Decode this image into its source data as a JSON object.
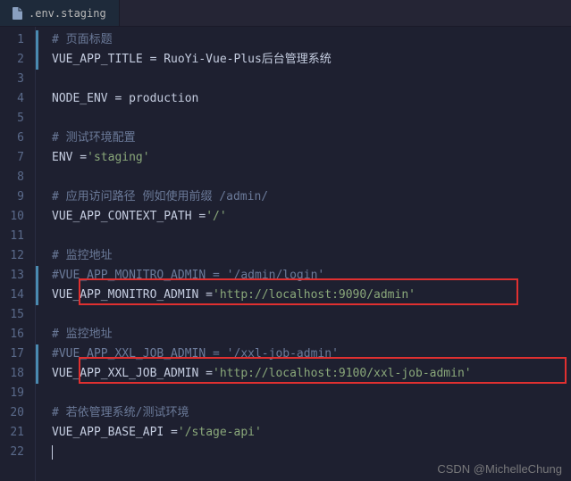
{
  "tab": {
    "filename": ".env.staging"
  },
  "lines": [
    {
      "num": 1,
      "type": "comment",
      "text": "# 页面标题",
      "modified": true
    },
    {
      "num": 2,
      "type": "code",
      "text": "VUE_APP_TITLE = RuoYi-Vue-Plus后台管理系统",
      "modified": true
    },
    {
      "num": 3,
      "type": "blank",
      "text": "",
      "modified": false
    },
    {
      "num": 4,
      "type": "code",
      "text": "NODE_ENV = production",
      "modified": false
    },
    {
      "num": 5,
      "type": "blank",
      "text": "",
      "modified": false
    },
    {
      "num": 6,
      "type": "comment",
      "text": "# 测试环境配置",
      "modified": false
    },
    {
      "num": 7,
      "type": "assign",
      "key": "ENV = ",
      "val": "'staging'",
      "modified": false
    },
    {
      "num": 8,
      "type": "blank",
      "text": "",
      "modified": false
    },
    {
      "num": 9,
      "type": "comment",
      "text": "# 应用访问路径 例如使用前缀 /admin/",
      "modified": false
    },
    {
      "num": 10,
      "type": "assign",
      "key": "VUE_APP_CONTEXT_PATH = ",
      "val": "'/'",
      "modified": false
    },
    {
      "num": 11,
      "type": "blank",
      "text": "",
      "modified": false
    },
    {
      "num": 12,
      "type": "comment",
      "text": "# 监控地址",
      "modified": false
    },
    {
      "num": 13,
      "type": "comment",
      "text": "#VUE_APP_MONITRO_ADMIN = '/admin/login'",
      "modified": true
    },
    {
      "num": 14,
      "type": "assign",
      "key": "VUE_APP_MONITRO_ADMIN = ",
      "val": "'http://localhost:9090/admin'",
      "modified": true
    },
    {
      "num": 15,
      "type": "blank",
      "text": "",
      "modified": false
    },
    {
      "num": 16,
      "type": "comment",
      "text": "# 监控地址",
      "modified": false
    },
    {
      "num": 17,
      "type": "comment",
      "text": "#VUE_APP_XXL_JOB_ADMIN = '/xxl-job-admin'",
      "modified": true
    },
    {
      "num": 18,
      "type": "assign",
      "key": "VUE_APP_XXL_JOB_ADMIN = ",
      "val": "'http://localhost:9100/xxl-job-admin'",
      "modified": true
    },
    {
      "num": 19,
      "type": "blank",
      "text": "",
      "modified": false
    },
    {
      "num": 20,
      "type": "comment",
      "text": "# 若依管理系统/测试环境",
      "modified": false
    },
    {
      "num": 21,
      "type": "assign",
      "key": "VUE_APP_BASE_API = ",
      "val": "'/stage-api'",
      "modified": false
    },
    {
      "num": 22,
      "type": "cursor",
      "text": "",
      "modified": false
    }
  ],
  "watermark": "CSDN @MichelleChung"
}
